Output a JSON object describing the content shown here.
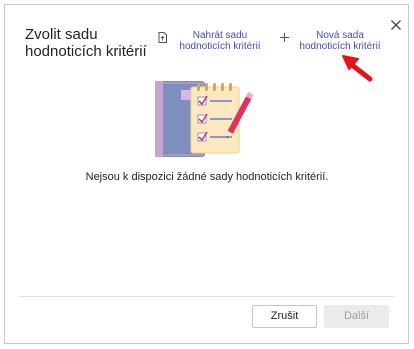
{
  "dialog": {
    "title": "Zvolit sadu hodnoticích kritérií",
    "upload_label": "Nahrát sadu hodnoticích kritérií",
    "new_set_label": "Nová sada hodnoticích kritérií",
    "empty_message": "Nejsou k dispozici žádné sady hodnoticích kritérií.",
    "cancel_label": "Zrušit",
    "next_label": "Další"
  },
  "icons": {
    "upload": "document-upload-icon",
    "new": "plus-icon",
    "close": "close-icon"
  },
  "colors": {
    "accent": "#464eb8",
    "arrow": "#e8121b",
    "disabled_bg": "#edebe9"
  },
  "state": {
    "next_enabled": false
  }
}
